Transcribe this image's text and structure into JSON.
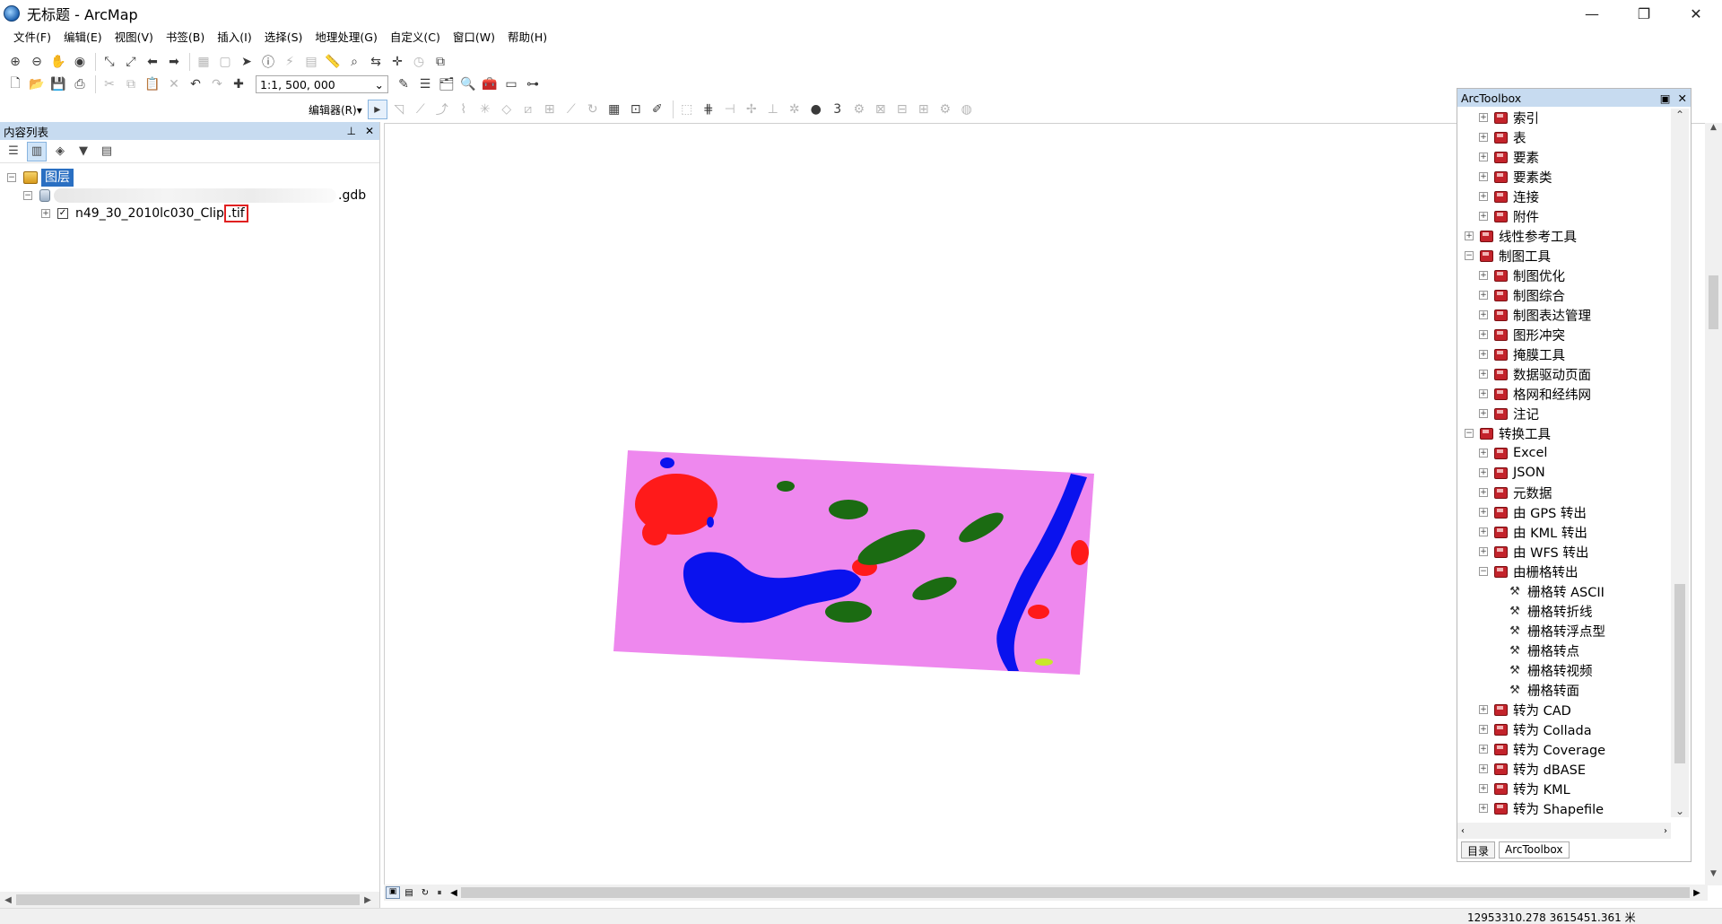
{
  "window": {
    "title": "无标题 - ArcMap",
    "minimize": "—",
    "maximize": "❐",
    "close": "✕"
  },
  "menus": [
    "文件(F)",
    "编辑(E)",
    "视图(V)",
    "书签(B)",
    "插入(I)",
    "选择(S)",
    "地理处理(G)",
    "自定义(C)",
    "窗口(W)",
    "帮助(H)"
  ],
  "toolbar": {
    "scale": "1:1, 500, 000",
    "editor_label": "编辑器(R)▾"
  },
  "toc": {
    "title": "内容列表",
    "root": "图层",
    "gdb_suffix": ".gdb",
    "layer_name_prefix": "n49_30_2010lc030_Clip",
    "layer_name_ext": ".tif"
  },
  "toolbox": {
    "title": "ArcToolbox",
    "items": [
      {
        "label": "索引",
        "level": 1,
        "kind": "box"
      },
      {
        "label": "表",
        "level": 1,
        "kind": "box"
      },
      {
        "label": "要素",
        "level": 1,
        "kind": "box"
      },
      {
        "label": "要素类",
        "level": 1,
        "kind": "box"
      },
      {
        "label": "连接",
        "level": 1,
        "kind": "box"
      },
      {
        "label": "附件",
        "level": 1,
        "kind": "box"
      },
      {
        "label": "线性参考工具",
        "level": 0,
        "kind": "box"
      },
      {
        "label": "制图工具",
        "level": 0,
        "kind": "box",
        "expanded": true
      },
      {
        "label": "制图优化",
        "level": 1,
        "kind": "box"
      },
      {
        "label": "制图综合",
        "level": 1,
        "kind": "box"
      },
      {
        "label": "制图表达管理",
        "level": 1,
        "kind": "box"
      },
      {
        "label": "图形冲突",
        "level": 1,
        "kind": "box"
      },
      {
        "label": "掩膜工具",
        "level": 1,
        "kind": "box"
      },
      {
        "label": "数据驱动页面",
        "level": 1,
        "kind": "box"
      },
      {
        "label": "格网和经纬网",
        "level": 1,
        "kind": "box"
      },
      {
        "label": "注记",
        "level": 1,
        "kind": "box"
      },
      {
        "label": "转换工具",
        "level": 0,
        "kind": "box",
        "expanded": true
      },
      {
        "label": "Excel",
        "level": 1,
        "kind": "box"
      },
      {
        "label": "JSON",
        "level": 1,
        "kind": "box"
      },
      {
        "label": "元数据",
        "level": 1,
        "kind": "box"
      },
      {
        "label": "由 GPS 转出",
        "level": 1,
        "kind": "box"
      },
      {
        "label": "由 KML 转出",
        "level": 1,
        "kind": "box"
      },
      {
        "label": "由 WFS 转出",
        "level": 1,
        "kind": "box"
      },
      {
        "label": "由栅格转出",
        "level": 1,
        "kind": "box",
        "expanded": true
      },
      {
        "label": "栅格转 ASCII",
        "level": 2,
        "kind": "tool"
      },
      {
        "label": "栅格转折线",
        "level": 2,
        "kind": "tool"
      },
      {
        "label": "栅格转浮点型",
        "level": 2,
        "kind": "tool"
      },
      {
        "label": "栅格转点",
        "level": 2,
        "kind": "tool"
      },
      {
        "label": "栅格转视频",
        "level": 2,
        "kind": "tool"
      },
      {
        "label": "栅格转面",
        "level": 2,
        "kind": "tool"
      },
      {
        "label": "转为 CAD",
        "level": 1,
        "kind": "box"
      },
      {
        "label": "转为 Collada",
        "level": 1,
        "kind": "box"
      },
      {
        "label": "转为 Coverage",
        "level": 1,
        "kind": "box"
      },
      {
        "label": "转为 dBASE",
        "level": 1,
        "kind": "box"
      },
      {
        "label": "转为 KML",
        "level": 1,
        "kind": "box"
      },
      {
        "label": "转为 Shapefile",
        "level": 1,
        "kind": "box"
      }
    ],
    "tabs": [
      "目录",
      "ArcToolbox"
    ]
  },
  "status": {
    "coordinates": "12953310.278  3615451.361 米"
  },
  "colors": {
    "land": "#ee88ee",
    "water": "#0a12ee",
    "urban": "#ff1a1a",
    "forest": "#1b6b12"
  }
}
